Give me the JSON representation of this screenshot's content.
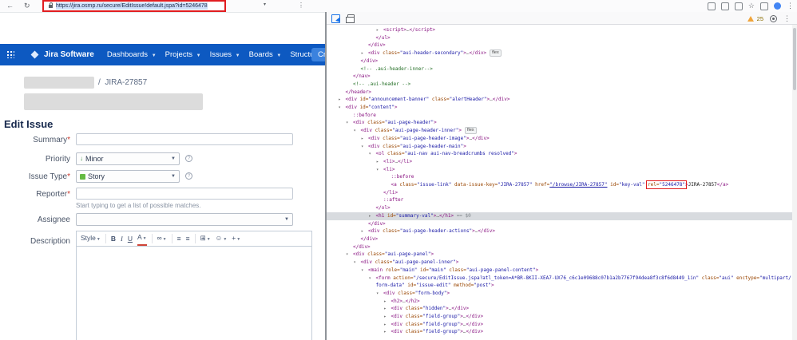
{
  "browser": {
    "url": "https://jira.osmp.ru/secure/EditIssue!default.jspa?id=5246478",
    "annotation_color": "#e11d20"
  },
  "navbar": {
    "logo": "Jira Software",
    "items": [
      "Dashboards",
      "Projects",
      "Issues",
      "Boards",
      "Structure"
    ],
    "create_label": "Create",
    "bg": "#0d59c1",
    "create_bg": "#3b82de"
  },
  "breadcrumb": {
    "separator": "/",
    "issue_key": "JIRA-27857"
  },
  "page": {
    "title": "Edit Issue"
  },
  "form": {
    "required_mark": "*",
    "summary": {
      "label": "Summary",
      "value": ""
    },
    "priority": {
      "label": "Priority",
      "value": "Minor"
    },
    "issue_type": {
      "label": "Issue Type",
      "value": "Story"
    },
    "reporter": {
      "label": "Reporter",
      "value": "",
      "hint": "Start typing to get a list of possible matches."
    },
    "assignee": {
      "label": "Assignee",
      "value": ""
    },
    "description": {
      "label": "Description"
    },
    "editor_toolbar": [
      {
        "type": "style",
        "label": "Style",
        "caret": true,
        "name": "style-dropdown"
      },
      {
        "type": "sep"
      },
      {
        "type": "b",
        "label": "B",
        "name": "bold-button"
      },
      {
        "type": "i",
        "label": "I",
        "name": "italic-button"
      },
      {
        "type": "u",
        "label": "U",
        "name": "underline-button"
      },
      {
        "type": "color",
        "label": "A",
        "caret": true,
        "name": "text-color-button"
      },
      {
        "type": "sep"
      },
      {
        "type": "link",
        "label": "∞",
        "caret": true,
        "name": "link-button"
      },
      {
        "type": "sep"
      },
      {
        "type": "ul",
        "label": "≡",
        "name": "bullet-list-button"
      },
      {
        "type": "ol",
        "label": "≡",
        "name": "numbered-list-button"
      },
      {
        "type": "sep"
      },
      {
        "type": "table",
        "label": "⊞",
        "caret": true,
        "name": "table-button"
      },
      {
        "type": "emoji",
        "label": "☺",
        "caret": true,
        "name": "emoji-button"
      },
      {
        "type": "plus",
        "label": "+",
        "caret": true,
        "name": "insert-more-button"
      }
    ]
  },
  "devtools": {
    "warning_count": "25",
    "selected_marker": " == $0",
    "tree": [
      {
        "lvl": 6,
        "arrow": "c",
        "tokens": [
          [
            "tag",
            "<script>"
          ],
          [
            "ell",
            "…"
          ],
          [
            "tag",
            "</script>"
          ]
        ]
      },
      {
        "lvl": 5,
        "tokens": [
          [
            "tag",
            "</ul>"
          ]
        ]
      },
      {
        "lvl": 4,
        "tokens": [
          [
            "tag",
            "</div>"
          ]
        ]
      },
      {
        "lvl": 4,
        "arrow": "c",
        "badge": "flex",
        "tokens": [
          [
            "tag",
            "<div "
          ],
          [
            "attr",
            "class="
          ],
          [
            "val",
            "\"aui-header-secondary\""
          ],
          [
            "tag",
            ">"
          ],
          [
            "ell",
            "…"
          ],
          [
            "tag",
            "</div>"
          ]
        ]
      },
      {
        "lvl": 3,
        "tokens": [
          [
            "tag",
            "</div>"
          ]
        ]
      },
      {
        "lvl": 3,
        "tokens": [
          [
            "com",
            "<!-- .aui-header-inner-->"
          ]
        ]
      },
      {
        "lvl": 2,
        "tokens": [
          [
            "tag",
            "</nav>"
          ]
        ]
      },
      {
        "lvl": 2,
        "tokens": [
          [
            "com",
            "<!-- .aui-header -->"
          ]
        ]
      },
      {
        "lvl": 1,
        "tokens": [
          [
            "tag",
            "</header>"
          ]
        ]
      },
      {
        "lvl": 1,
        "arrow": "c",
        "tokens": [
          [
            "tag",
            "<div "
          ],
          [
            "attr",
            "id="
          ],
          [
            "val",
            "\"announcement-banner\" "
          ],
          [
            "attr",
            "class="
          ],
          [
            "val",
            "\"alertHeader\""
          ],
          [
            "tag",
            ">"
          ],
          [
            "ell",
            "…"
          ],
          [
            "tag",
            "</div>"
          ]
        ]
      },
      {
        "lvl": 1,
        "arrow": "e",
        "tokens": [
          [
            "tag",
            "<div "
          ],
          [
            "attr",
            "id="
          ],
          [
            "val",
            "\"content\""
          ],
          [
            "tag",
            ">"
          ]
        ]
      },
      {
        "lvl": 2,
        "tokens": [
          [
            "pse",
            "::before"
          ]
        ]
      },
      {
        "lvl": 2,
        "arrow": "e",
        "tokens": [
          [
            "tag",
            "<div "
          ],
          [
            "attr",
            "class="
          ],
          [
            "val",
            "\"aui-page-header\""
          ],
          [
            "tag",
            ">"
          ]
        ]
      },
      {
        "lvl": 3,
        "arrow": "e",
        "badge": "flex",
        "tokens": [
          [
            "tag",
            "<div "
          ],
          [
            "attr",
            "class="
          ],
          [
            "val",
            "\"aui-page-header-inner\""
          ],
          [
            "tag",
            ">"
          ]
        ]
      },
      {
        "lvl": 4,
        "arrow": "c",
        "tokens": [
          [
            "tag",
            "<div "
          ],
          [
            "attr",
            "class="
          ],
          [
            "val",
            "\"aui-page-header-image\""
          ],
          [
            "tag",
            ">"
          ],
          [
            "ell",
            "…"
          ],
          [
            "tag",
            "</div>"
          ]
        ]
      },
      {
        "lvl": 4,
        "arrow": "e",
        "tokens": [
          [
            "tag",
            "<div "
          ],
          [
            "attr",
            "class="
          ],
          [
            "val",
            "\"aui-page-header-main\""
          ],
          [
            "tag",
            ">"
          ]
        ]
      },
      {
        "lvl": 5,
        "arrow": "e",
        "tokens": [
          [
            "tag",
            "<ol "
          ],
          [
            "attr",
            "class="
          ],
          [
            "val",
            "\"aui-nav aui-nav-breadcrumbs resolved\""
          ],
          [
            "tag",
            ">"
          ]
        ]
      },
      {
        "lvl": 6,
        "arrow": "c",
        "tokens": [
          [
            "tag",
            "<li>"
          ],
          [
            "ell",
            "…"
          ],
          [
            "tag",
            "</li>"
          ]
        ]
      },
      {
        "lvl": 6,
        "arrow": "e",
        "tokens": [
          [
            "tag",
            "<li>"
          ]
        ]
      },
      {
        "lvl": 7,
        "tokens": [
          [
            "pse",
            "::before"
          ]
        ]
      },
      {
        "lvl": 7,
        "tokens": [
          [
            "tag",
            "<a "
          ],
          [
            "attr",
            "class="
          ],
          [
            "val",
            "\"issue-link\" "
          ],
          [
            "attr",
            "data-issue-key="
          ],
          [
            "val",
            "\"JIRA-27857\" "
          ],
          [
            "attr",
            "href="
          ],
          [
            "link",
            "\"/browse/JIRA-27857\""
          ],
          [
            "txt",
            " "
          ],
          [
            "attr",
            "id="
          ],
          [
            "val",
            "\"key-val\" "
          ],
          [
            "attr",
            "rel="
          ],
          [
            "val",
            "\"5246478\"",
            "box"
          ],
          [
            "tag",
            ">"
          ],
          [
            "txt",
            "JIRA-27857"
          ],
          [
            "tag",
            "</a>"
          ]
        ]
      },
      {
        "lvl": 6,
        "tokens": [
          [
            "tag",
            "</li>"
          ]
        ]
      },
      {
        "lvl": 6,
        "tokens": [
          [
            "pse",
            "::after"
          ]
        ]
      },
      {
        "lvl": 5,
        "tokens": [
          [
            "tag",
            "</ol>"
          ]
        ]
      },
      {
        "lvl": 5,
        "arrow": "c",
        "selected": true,
        "tokens": [
          [
            "tag",
            "<h1 "
          ],
          [
            "attr",
            "id="
          ],
          [
            "val",
            "\"summary-val\""
          ],
          [
            "tag",
            ">"
          ],
          [
            "ell",
            "…"
          ],
          [
            "tag",
            "</h1>"
          ],
          [
            "mark",
            " == $0"
          ]
        ]
      },
      {
        "lvl": 4,
        "tokens": [
          [
            "tag",
            "</div>"
          ]
        ]
      },
      {
        "lvl": 4,
        "arrow": "c",
        "tokens": [
          [
            "tag",
            "<div "
          ],
          [
            "attr",
            "class="
          ],
          [
            "val",
            "\"aui-page-header-actions\""
          ],
          [
            "tag",
            ">"
          ],
          [
            "ell",
            "…"
          ],
          [
            "tag",
            "</div>"
          ]
        ]
      },
      {
        "lvl": 3,
        "tokens": [
          [
            "tag",
            "</div>"
          ]
        ]
      },
      {
        "lvl": 2,
        "tokens": [
          [
            "tag",
            "</div>"
          ]
        ]
      },
      {
        "lvl": 2,
        "arrow": "e",
        "tokens": [
          [
            "tag",
            "<div "
          ],
          [
            "attr",
            "class="
          ],
          [
            "val",
            "\"aui-page-panel\""
          ],
          [
            "tag",
            ">"
          ]
        ]
      },
      {
        "lvl": 3,
        "arrow": "e",
        "tokens": [
          [
            "tag",
            "<div "
          ],
          [
            "attr",
            "class="
          ],
          [
            "val",
            "\"aui-page-panel-inner\""
          ],
          [
            "tag",
            ">"
          ]
        ]
      },
      {
        "lvl": 4,
        "arrow": "e",
        "tokens": [
          [
            "tag",
            "<main "
          ],
          [
            "attr",
            "role="
          ],
          [
            "val",
            "\"main\" "
          ],
          [
            "attr",
            "id="
          ],
          [
            "val",
            "\"main\" "
          ],
          [
            "attr",
            "class="
          ],
          [
            "val",
            "\"aui-page-panel-content\""
          ],
          [
            "tag",
            ">"
          ]
        ]
      },
      {
        "lvl": 5,
        "arrow": "e",
        "tokens": [
          [
            "tag",
            "<form "
          ],
          [
            "attr",
            "action="
          ],
          [
            "val",
            "\"/secure/EditIssue.jspa?atl_token=A*BR-8KII-XEA7-UX76_c6c1e09688c07b1a2b7767f94dea8f3c8f6d8449_1in\" "
          ],
          [
            "attr",
            "class="
          ],
          [
            "val",
            "\"aui\" "
          ],
          [
            "attr",
            "enctype="
          ],
          [
            "val",
            "\"multipart/form-data\" "
          ],
          [
            "attr",
            "id="
          ],
          [
            "val",
            "\"issue-edit\" "
          ],
          [
            "attr",
            "method="
          ],
          [
            "val",
            "\"post\""
          ],
          [
            "tag",
            ">"
          ]
        ]
      },
      {
        "lvl": 6,
        "arrow": "e",
        "tokens": [
          [
            "tag",
            "<div "
          ],
          [
            "attr",
            "class="
          ],
          [
            "val",
            "\"form-body\""
          ],
          [
            "tag",
            ">"
          ]
        ]
      },
      {
        "lvl": 7,
        "arrow": "c",
        "tokens": [
          [
            "tag",
            "<h2>"
          ],
          [
            "ell",
            "…"
          ],
          [
            "tag",
            "</h2>"
          ]
        ]
      },
      {
        "lvl": 7,
        "arrow": "c",
        "tokens": [
          [
            "tag",
            "<div "
          ],
          [
            "attr",
            "class="
          ],
          [
            "val",
            "\"hidden\""
          ],
          [
            "tag",
            ">"
          ],
          [
            "ell",
            "…"
          ],
          [
            "tag",
            "</div>"
          ]
        ]
      },
      {
        "lvl": 7,
        "arrow": "c",
        "tokens": [
          [
            "tag",
            "<div "
          ],
          [
            "attr",
            "class="
          ],
          [
            "val",
            "\"field-group\""
          ],
          [
            "tag",
            ">"
          ],
          [
            "ell",
            "…"
          ],
          [
            "tag",
            "</div>"
          ]
        ]
      },
      {
        "lvl": 7,
        "arrow": "c",
        "tokens": [
          [
            "tag",
            "<div "
          ],
          [
            "attr",
            "class="
          ],
          [
            "val",
            "\"field-group\""
          ],
          [
            "tag",
            ">"
          ],
          [
            "ell",
            "…"
          ],
          [
            "tag",
            "</div>"
          ]
        ]
      },
      {
        "lvl": 7,
        "arrow": "c",
        "tokens": [
          [
            "tag",
            "<div "
          ],
          [
            "attr",
            "class="
          ],
          [
            "val",
            "\"field-group\""
          ],
          [
            "tag",
            ">"
          ],
          [
            "ell",
            "…"
          ],
          [
            "tag",
            "</div>"
          ]
        ]
      }
    ]
  }
}
